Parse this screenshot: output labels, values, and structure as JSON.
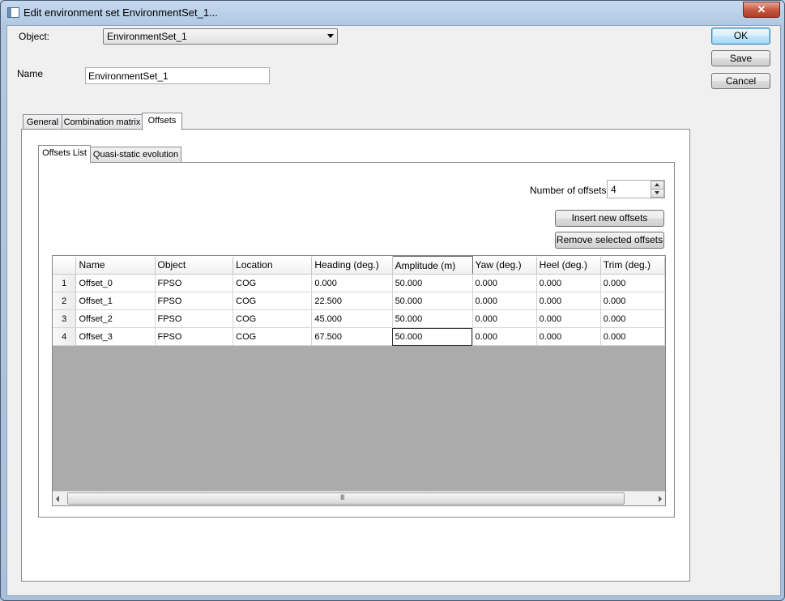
{
  "window": {
    "title": "Edit environment set EnvironmentSet_1...",
    "close_glyph": "✕"
  },
  "form": {
    "object_label": "Object:",
    "object_value": "EnvironmentSet_1",
    "name_label": "Name",
    "name_value": "EnvironmentSet_1"
  },
  "buttons": {
    "ok": "OK",
    "save": "Save",
    "cancel": "Cancel"
  },
  "tabs": [
    "General",
    "Combination matrix",
    "Offsets"
  ],
  "subtabs": [
    "Offsets List",
    "Quasi-static evolution"
  ],
  "offsets": {
    "number_label": "Number of offsets:",
    "number_value": "4",
    "insert_label": "Insert new offsets",
    "remove_label": "Remove selected offsets"
  },
  "table": {
    "columns": [
      "Name",
      "Object",
      "Location",
      "Heading (deg.)",
      "Amplitude (m)",
      "Yaw (deg.)",
      "Heel (deg.)",
      "Trim (deg.)"
    ],
    "rows": [
      {
        "index": "1",
        "cells": [
          "Offset_0",
          "FPSO",
          "COG",
          "0.000",
          "50.000",
          "0.000",
          "0.000",
          "0.000"
        ]
      },
      {
        "index": "2",
        "cells": [
          "Offset_1",
          "FPSO",
          "COG",
          "22.500",
          "50.000",
          "0.000",
          "0.000",
          "0.000"
        ]
      },
      {
        "index": "3",
        "cells": [
          "Offset_2",
          "FPSO",
          "COG",
          "45.000",
          "50.000",
          "0.000",
          "0.000",
          "0.000"
        ]
      },
      {
        "index": "4",
        "cells": [
          "Offset_3",
          "FPSO",
          "COG",
          "67.500",
          "50.000",
          "0.000",
          "0.000",
          "0.000"
        ]
      }
    ],
    "scroll_grip": "III"
  }
}
